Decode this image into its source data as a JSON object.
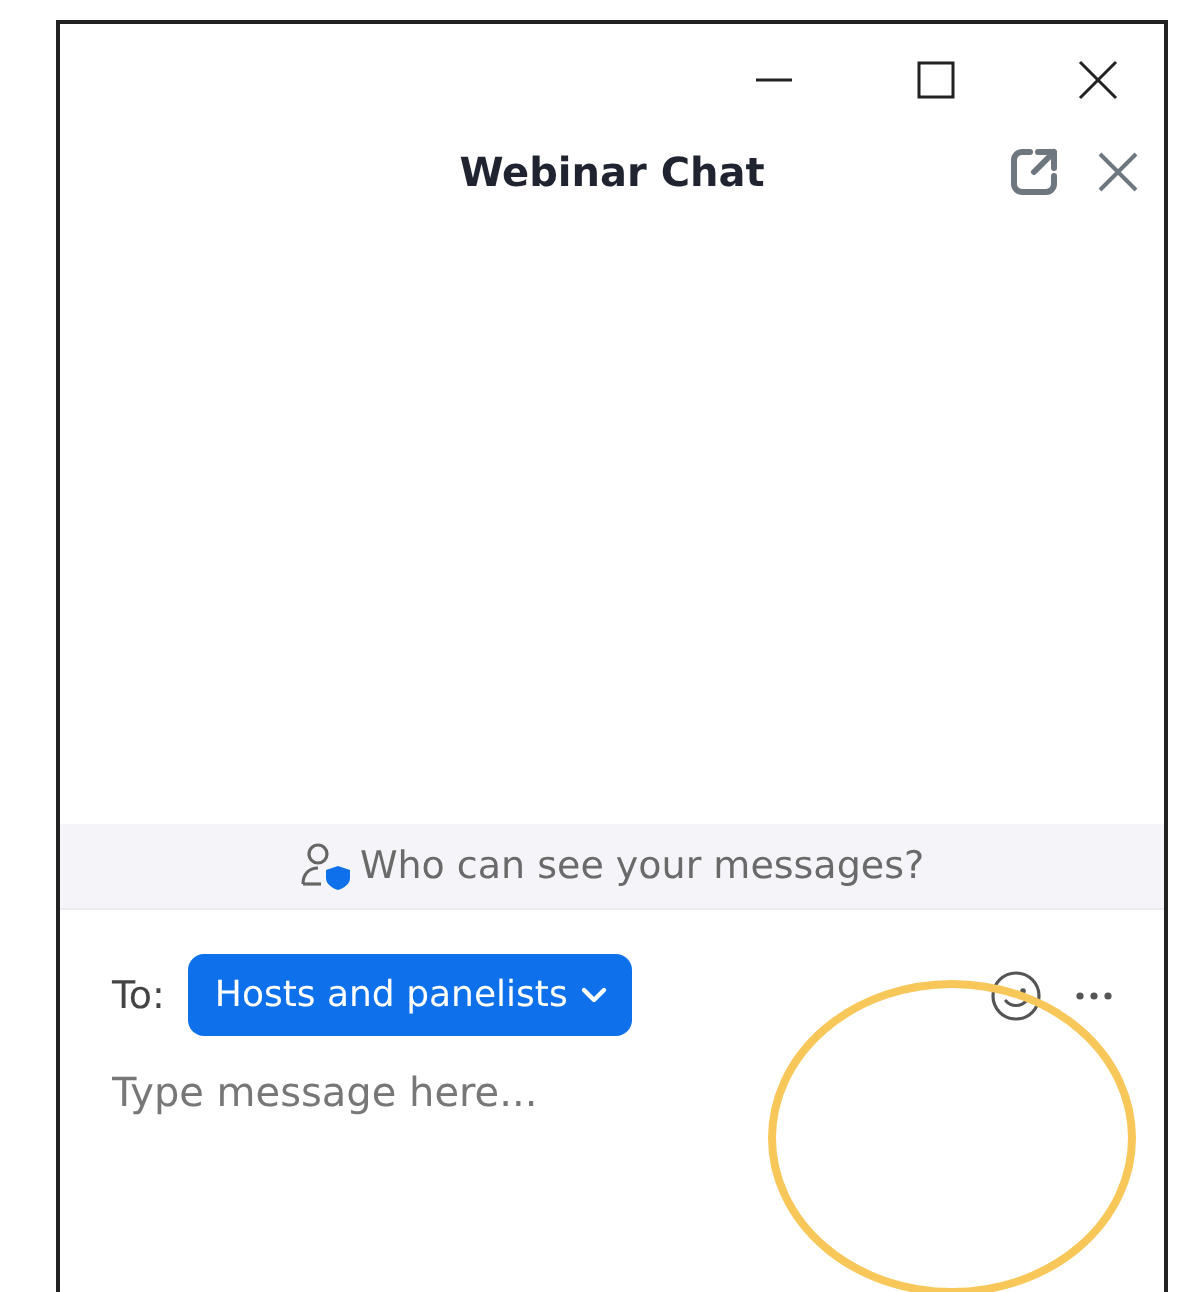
{
  "window": {
    "controls": [
      {
        "kind": "minimize"
      },
      {
        "kind": "maximize"
      },
      {
        "kind": "close"
      }
    ]
  },
  "header": {
    "title": "Webinar Chat",
    "actions": [
      {
        "kind": "popout"
      },
      {
        "kind": "close"
      }
    ]
  },
  "privacy_notice": {
    "text": "Who can see your messages?"
  },
  "compose": {
    "to_label": "To:",
    "recipient": "Hosts and panelists",
    "tools": [
      {
        "kind": "emoji"
      },
      {
        "kind": "more"
      }
    ],
    "message": {
      "placeholder": "Type message here..."
    }
  },
  "annotations": [
    {
      "kind": "ellipse"
    }
  ]
}
